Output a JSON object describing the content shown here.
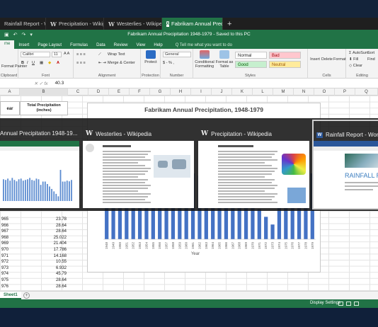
{
  "browser_tabs": [
    {
      "label": "Rainfall Report - Word",
      "icon": "word-icon",
      "active": false
    },
    {
      "label": "Precipitation - Wikipedia",
      "icon": "wikipedia-icon",
      "active": false
    },
    {
      "label": "Westerlies - Wikipedia",
      "icon": "wikipedia-icon",
      "active": false
    },
    {
      "label": "Fabrikam Annual Prec",
      "icon": "excel-icon",
      "active": true
    }
  ],
  "window_title": "Fabrikam Annual Precipitation 1948-1979 - Saved to this PC",
  "ribbon_tabs": [
    "me",
    "Insert",
    "Page Layout",
    "Formulas",
    "Data",
    "Review",
    "View",
    "Help",
    "Q Tell me what you want to do"
  ],
  "ribbon": {
    "clipboard": {
      "format_painter": "Format Painter",
      "label": "Clipboard"
    },
    "font": {
      "name": "Calibri",
      "size": "11",
      "label": "Font"
    },
    "alignment": {
      "wrap": "Wrap Text",
      "merge": "Merge & Center",
      "label": "Alignment"
    },
    "protection": {
      "protect": "Protect",
      "label": "Protection"
    },
    "number": {
      "format": "General",
      "label": "Number"
    },
    "styles": {
      "conditional": "Conditional Formatting",
      "format_as_table": "Format as Table",
      "cells": [
        {
          "label": "Normal",
          "bg": "#ffffff",
          "color": "#222222"
        },
        {
          "label": "Bad",
          "bg": "#ffc7ce",
          "color": "#9c0006"
        },
        {
          "label": "Good",
          "bg": "#c6efce",
          "color": "#006100"
        },
        {
          "label": "Neutral",
          "bg": "#ffeb9c",
          "color": "#9c5700"
        }
      ],
      "label": "Styles"
    },
    "cells": {
      "insert": "Insert",
      "delete": "Delete",
      "format": "Format",
      "label": "Cells"
    },
    "editing": {
      "autosum": "AutoSum",
      "fill": "Fill",
      "clear": "Clear",
      "sort": "Sort",
      "find": "Find",
      "label": "Editing"
    }
  },
  "formula_bar": {
    "value": "40.3"
  },
  "columns": [
    "A",
    "B",
    "C",
    "D",
    "E",
    "F",
    "G",
    "H",
    "I",
    "J",
    "K",
    "L",
    "M",
    "N",
    "O",
    "P",
    "Q"
  ],
  "table_headers": {
    "year": "ear",
    "total": "Total Precipitation (inches)"
  },
  "data_rows": [
    {
      "year": "965",
      "value": "23.78"
    },
    {
      "year": "966",
      "value": "28.64"
    },
    {
      "year": "967",
      "value": "28.64"
    },
    {
      "year": "968",
      "value": "25.022"
    },
    {
      "year": "969",
      "value": "21.404"
    },
    {
      "year": "970",
      "value": "17.786"
    },
    {
      "year": "971",
      "value": "14.168"
    },
    {
      "year": "972",
      "value": "10.55"
    },
    {
      "year": "973",
      "value": "6.932"
    },
    {
      "year": "974",
      "value": "45.79"
    },
    {
      "year": "975",
      "value": "28.64"
    },
    {
      "year": "976",
      "value": "28.64"
    }
  ],
  "chart_data": {
    "type": "bar",
    "title": "Fabrikam Annual Precipitation, 1948-1979",
    "xlabel": "Year",
    "ylabel": "",
    "categories": [
      "1948",
      "1949",
      "1950",
      "1951",
      "1952",
      "1953",
      "1954",
      "1955",
      "1956",
      "1957",
      "1958",
      "1959",
      "1960",
      "1961",
      "1962",
      "1963",
      "1964",
      "1965",
      "1966",
      "1967",
      "1968",
      "1969",
      "1970",
      "1971",
      "1972",
      "1973",
      "1974",
      "1975",
      "1976",
      "1977",
      "1978",
      "1979"
    ],
    "values": [
      32,
      31,
      33,
      30,
      34,
      31,
      29,
      32,
      33,
      30,
      31,
      32,
      34,
      31,
      30,
      33,
      32,
      23.78,
      28.64,
      28.64,
      25.022,
      21.404,
      17.786,
      14.168,
      10.55,
      6.932,
      45.79,
      28.64,
      28.64,
      30,
      29,
      31
    ],
    "ylim": [
      0,
      50
    ],
    "bar_color": "#4472c4"
  },
  "task_switcher": [
    {
      "title": "Annual Precipitation 1948-19...",
      "icon": "excel-icon"
    },
    {
      "title": "Westerlies - Wikipedia",
      "icon": "wikipedia-icon"
    },
    {
      "title": "Precipitation - Wikipedia",
      "icon": "wikipedia-icon"
    },
    {
      "title": "Rainfall Report - Word",
      "icon": "word-icon",
      "doc_heading": "RAINFALL REPO"
    }
  ],
  "sheet_tab": "Sheet1",
  "status_bar": {
    "display_settings": "Display Settings"
  }
}
